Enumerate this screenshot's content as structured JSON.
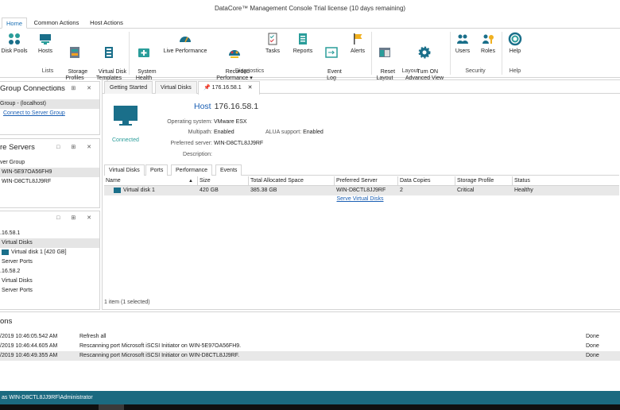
{
  "window": {
    "title": "DataCore™ Management Console   Trial license (10 days remaining)"
  },
  "ribbon_tabs": [
    "Home",
    "Common Actions",
    "Host Actions"
  ],
  "ribbon": {
    "buttons": [
      {
        "label": "Disk Pools",
        "icon": "disk-pools-icon"
      },
      {
        "label": "Hosts",
        "icon": "hosts-icon"
      },
      {
        "label": "Storage\nProfiles",
        "icon": "storage-profiles-icon"
      },
      {
        "label": "Virtual Disk\nTemplates",
        "icon": "templates-icon"
      },
      {
        "label": "System\nHealth",
        "icon": "system-health-icon"
      },
      {
        "label": "Live Performance",
        "icon": "gauge-icon"
      },
      {
        "label": "Recorded\nPerformance ▾",
        "icon": "recorded-performance-icon"
      },
      {
        "label": "Tasks",
        "icon": "tasks-icon"
      },
      {
        "label": "Reports",
        "icon": "reports-icon"
      },
      {
        "label": "Event\nLog",
        "icon": "event-log-icon"
      },
      {
        "label": "Alerts",
        "icon": "flag-icon"
      },
      {
        "label": "Reset\nLayout",
        "icon": "reset-layout-icon"
      },
      {
        "label": "Turn ON\nAdvanced View",
        "icon": "gear-icon"
      },
      {
        "label": "Users",
        "icon": "users-icon"
      },
      {
        "label": "Roles",
        "icon": "roles-icon"
      },
      {
        "label": "Help",
        "icon": "help-icon"
      }
    ],
    "groups": [
      "Lists",
      "Diagnostics",
      "Layout",
      "Security",
      "Help"
    ]
  },
  "server_group_panel": {
    "title": "Group Connections",
    "rows": [
      "Group - (localhost)",
      "Connect to Server Group"
    ]
  },
  "servers_panel": {
    "title": "re Servers",
    "rows": [
      "ver Group",
      "WIN-5E97OA56FH9",
      "WIN-D8CTL8JJ9RF"
    ]
  },
  "tree_panel": {
    "rows": [
      ".16.58.1",
      "Virtual Disks",
      "Virtual disk 1   [420 GB]",
      "Server Ports",
      ".16.58.2",
      "Virtual Disks",
      "Server Ports"
    ]
  },
  "doc_tabs": [
    "Getting Started",
    "Virtual Disks",
    "176.16.58.1"
  ],
  "host": {
    "label": "Host",
    "name": "176.16.58.1",
    "status": "Connected",
    "os_label": "Operating system:",
    "os": "VMware ESX",
    "multipath_label": "Multipath:",
    "multipath": "Enabled",
    "alua_label": "ALUA support:",
    "alua": "Enabled",
    "preferred_label": "Preferred server:",
    "preferred": "WIN-D8CTL8JJ9RF",
    "description_label": "Description:",
    "description": ""
  },
  "sub_tabs": [
    "Virtual Disks",
    "Ports",
    "Performance",
    "Events"
  ],
  "grid": {
    "columns": [
      "Name",
      "Size",
      "Total Allocated Space",
      "Preferred Server",
      "Data Copies",
      "Storage Profile",
      "Status"
    ],
    "rows": [
      [
        "Virtual disk 1",
        "420 GB",
        "385.38 GB",
        "WIN-D8CTL8JJ9RF",
        "2",
        "Critical",
        "Healthy"
      ]
    ],
    "serve_link": "Serve Virtual Disks",
    "footer": "1 item (1 selected)"
  },
  "actions_panel": {
    "title": "ons",
    "rows": [
      {
        "time": "/2019 10:46:05.542 AM",
        "text": "Refresh all",
        "status": "Done"
      },
      {
        "time": "/2019 10:46:44.605 AM",
        "text": "Rescanning port Microsoft iSCSI Initiator on WIN-5E97OA56FH9.",
        "status": "Done"
      },
      {
        "time": "/2019 10:46:49.355 AM",
        "text": "Rescanning port Microsoft iSCSI Initiator on WIN-D8CTL8JJ9RF.",
        "status": "Done"
      }
    ]
  },
  "statusbar": {
    "text": " as WIN-D8CTL8JJ9RF\\Administrator"
  }
}
